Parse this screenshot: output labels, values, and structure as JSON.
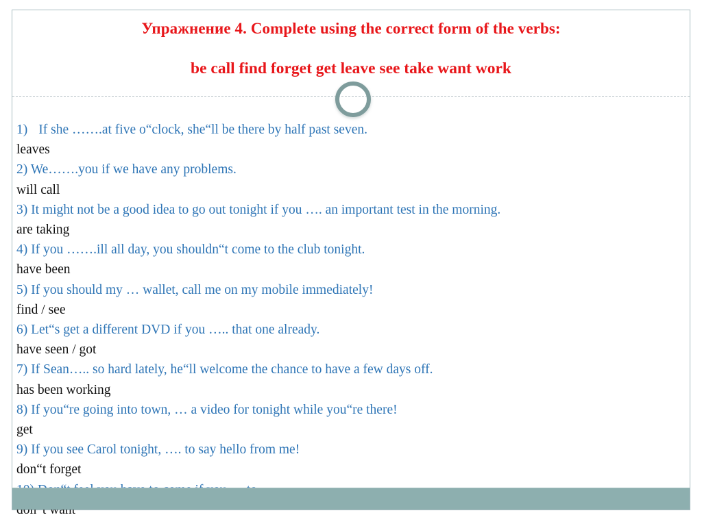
{
  "slide": {
    "title_line_1": "Упражнение 4. Complete using  the correct form of the verbs:",
    "title_line_2": "be call find forget get leave see take want work",
    "title_color": "#e8161a",
    "question_color": "#2e75b6",
    "answer_color": "#111111",
    "border_color": "#a9bcc0",
    "footer_color": "#8dafaf",
    "ornament_color": "#7e9c9c",
    "divider_color": "#b9c3c8"
  },
  "exercise": {
    "lines": [
      {
        "kind": "question",
        "number": "1)",
        "text": "If she …….at five o“clock, she“ll be there by half past seven."
      },
      {
        "kind": "answer",
        "text": "leaves"
      },
      {
        "kind": "question",
        "text": "2) We…….you if we have any problems."
      },
      {
        "kind": "answer",
        "text": "will call"
      },
      {
        "kind": "question",
        "text": "3) It might not be a good idea to go out tonight if you …. an important test in the morning."
      },
      {
        "kind": "answer",
        "text": "are taking"
      },
      {
        "kind": "question",
        "text": "4) If you …….ill all day, you shouldn“t come to the club tonight."
      },
      {
        "kind": "answer",
        "text": "have been"
      },
      {
        "kind": "question",
        "text": "5) If you should my … wallet, call me on my mobile immediately!"
      },
      {
        "kind": "answer",
        "text": "find / see"
      },
      {
        "kind": "question",
        "text": "6) Let“s get a different DVD if you ….. that one already."
      },
      {
        "kind": "answer",
        "text": "have seen / got"
      },
      {
        "kind": "question",
        "text": "7) If Sean….. so hard lately, he“ll welcome the chance to have a few days off."
      },
      {
        "kind": "answer",
        "text": "has been working"
      },
      {
        "kind": "question",
        "text": "8) If you“re going into town, … a video for tonight while you“re there!"
      },
      {
        "kind": "answer",
        "text": "get"
      },
      {
        "kind": "question",
        "text": "9) If you see Carol tonight, …. to say hello from me!"
      },
      {
        "kind": "answer",
        "text": "don“t forget"
      },
      {
        "kind": "question",
        "text": "10) Don“t feel you have to come if you…. to."
      },
      {
        "kind": "answer",
        "text": "don“t want"
      }
    ]
  }
}
